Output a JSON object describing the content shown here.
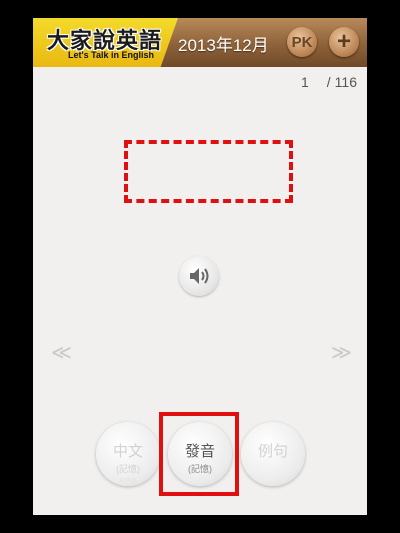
{
  "header": {
    "logo_cn": "大家說英語",
    "logo_en": "Let's Talk in English",
    "issue_date": "2013年12月",
    "pk_label": "PK",
    "add_label": "+"
  },
  "pager": {
    "current": "1",
    "total": "116"
  },
  "icons": {
    "speaker": "speaker-icon",
    "prev": "chevron-left-icon",
    "next": "chevron-right-icon"
  },
  "modes": {
    "chinese": {
      "label": "中文",
      "sub": "(記憶)",
      "dots": "○○○"
    },
    "pronounce": {
      "label": "發音",
      "sub": "(記憶)"
    },
    "example": {
      "label": "例句"
    }
  },
  "colors": {
    "highlight": "#e01010",
    "header_wood": "#8e6239",
    "logo_yellow": "#f3da2a"
  }
}
